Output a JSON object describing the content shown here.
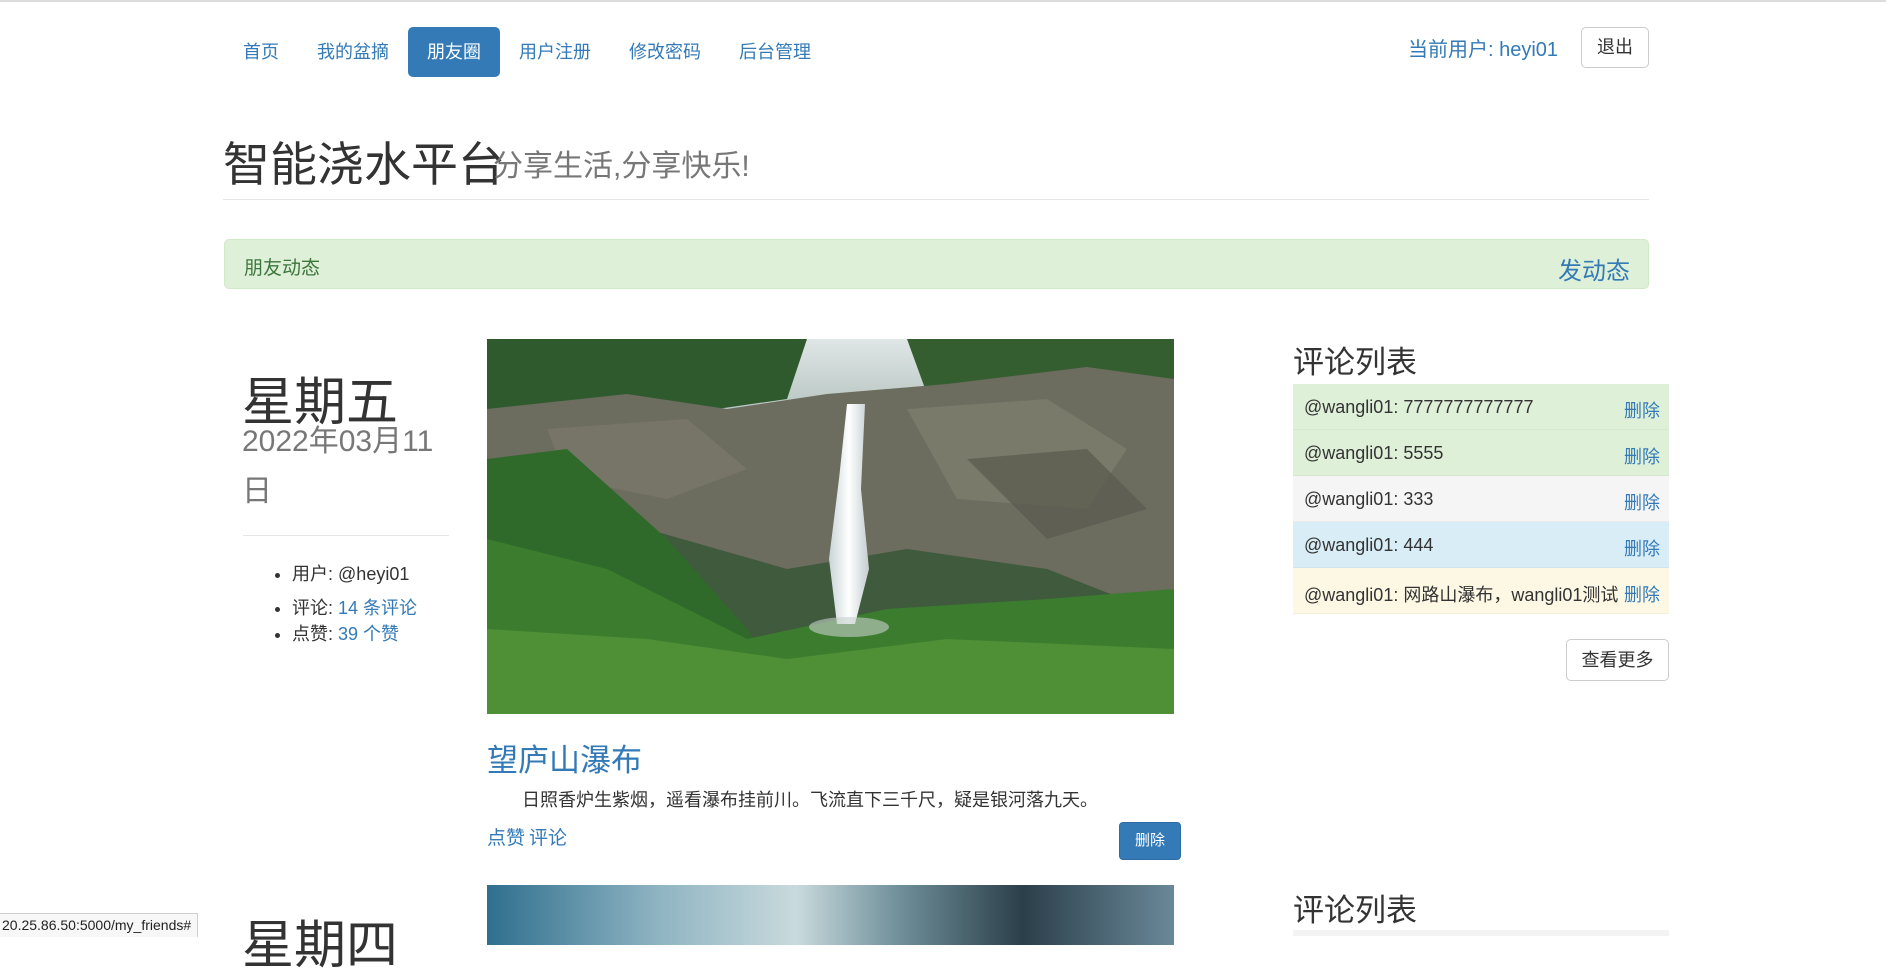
{
  "nav": {
    "items": [
      {
        "label": "首页"
      },
      {
        "label": "我的盆摘"
      },
      {
        "label": "朋友圈",
        "active": true
      },
      {
        "label": "用户注册"
      },
      {
        "label": "修改密码"
      },
      {
        "label": "后台管理"
      }
    ],
    "current_user": "当前用户: heyi01",
    "logout_label": "退出"
  },
  "header": {
    "title": "智能浇水平台",
    "subtitle": "分享生活,分享快乐!"
  },
  "alert": {
    "text": "朋友动态",
    "link": "发动态"
  },
  "post": {
    "weekday": "星期五",
    "date": "2022年03月11日",
    "meta": {
      "user_label": "用户:",
      "user_value": "@heyi01",
      "comments_label": "评论:",
      "comments_value": "14 条评论",
      "likes_label": "点赞:",
      "likes_value": "39 个赞"
    },
    "image_alt": "waterfall",
    "title": "望庐山瀑布",
    "text": "日照香炉生紫烟，遥看瀑布挂前川。飞流直下三千尺，疑是银河落九天。",
    "like_label": "点赞",
    "comment_label": "评论",
    "delete_label": "删除"
  },
  "comments": {
    "heading": "评论列表",
    "items": [
      {
        "text": "@wangli01: 7777777777777",
        "delete": "删除",
        "color": "#dff0d8"
      },
      {
        "text": "@wangli01: 5555",
        "delete": "删除",
        "color": "#dff0d8"
      },
      {
        "text": "@wangli01: 333",
        "delete": "删除",
        "color": "#f5f5f5"
      },
      {
        "text": "@wangli01: 444",
        "delete": "删除",
        "color": "#d9edf7"
      },
      {
        "text": "@wangli01: 网路山瀑布，wangli01测试",
        "delete": "删除",
        "color": "#fcf8e3"
      }
    ],
    "more_label": "查看更多"
  },
  "next_post": {
    "weekday": "星期四",
    "comments_heading": "评论列表"
  },
  "status_bar": {
    "url": "20.25.86.50:5000/my_friends#"
  },
  "colors": {
    "link": "#337ab7",
    "primary_button": "#337ab7",
    "success_bg": "#dff0d8",
    "success_text": "#3c763d"
  }
}
